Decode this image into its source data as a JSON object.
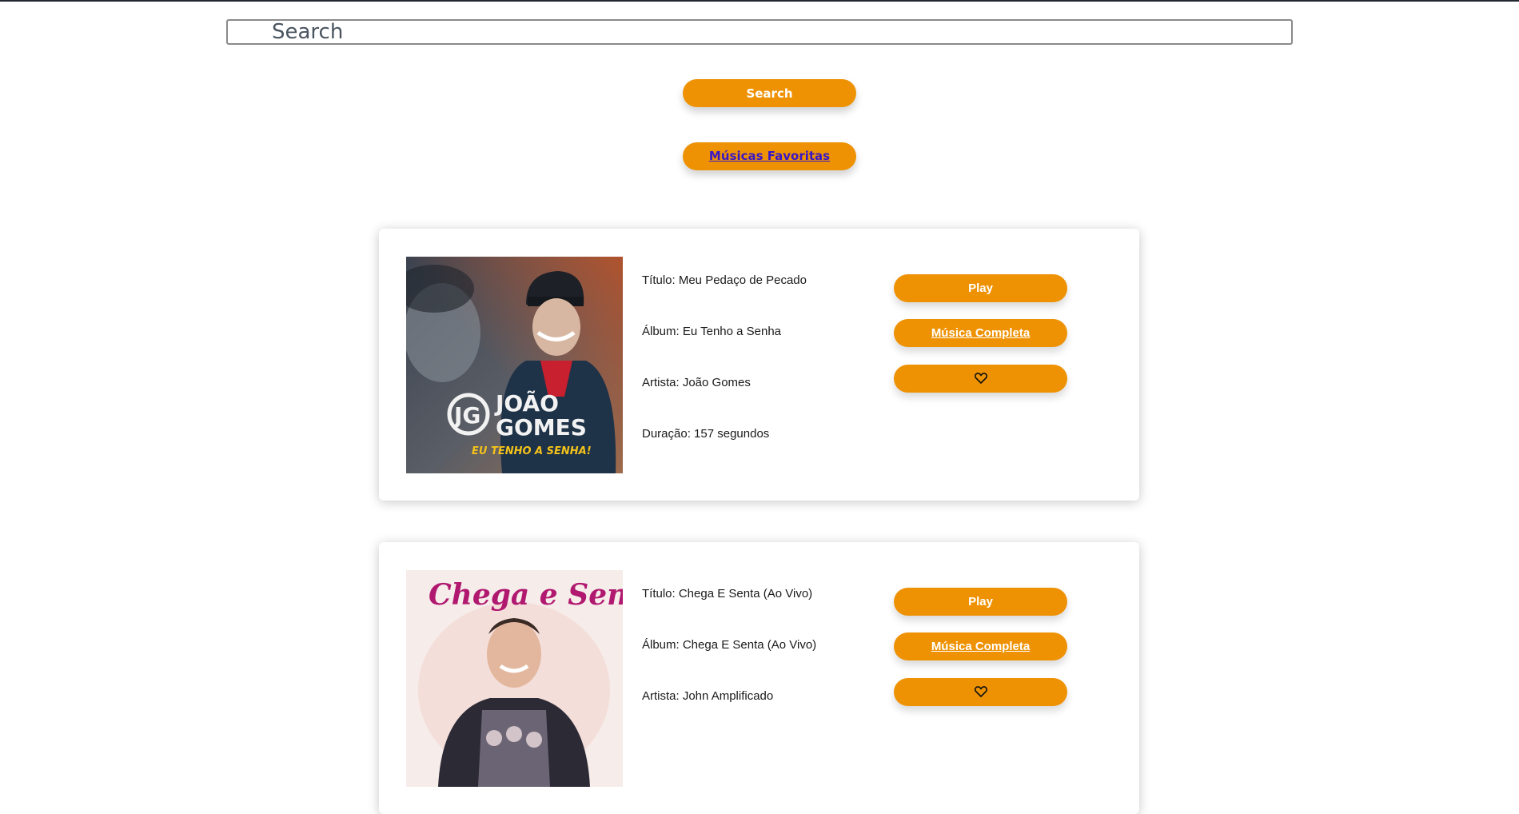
{
  "search": {
    "placeholder": "Search",
    "button_label": "Search"
  },
  "favorites_link": "Músicas Favoritas",
  "tracks": [
    {
      "title": "Título: Meu Pedaço de Pecado",
      "album": "Álbum: Eu Tenho a Senha",
      "artist": "Artista: João Gomes",
      "duration": "Duração: 157 segundos",
      "cover_text": [
        "JOÃO",
        "GOMES",
        "EU TENHO A SENHA!"
      ],
      "play_label": "Play",
      "full_label": "Música Completa",
      "favorite_icon": "heart-icon"
    },
    {
      "title": "Título: Chega E Senta (Ao Vivo)",
      "album": "Álbum: Chega E Senta (Ao Vivo)",
      "artist": "Artista: John Amplificado",
      "cover_text": [
        "Chega e Senta"
      ],
      "play_label": "Play",
      "full_label": "Música Completa",
      "favorite_icon": "heart-icon"
    }
  ],
  "colors": {
    "accent": "#ee9203",
    "link": "#3a17c6",
    "text": "#1a1a1a"
  }
}
